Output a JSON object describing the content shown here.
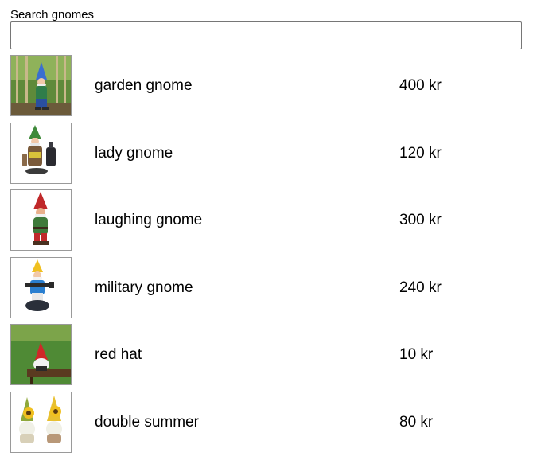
{
  "search": {
    "label": "Search gnomes",
    "value": "",
    "placeholder": ""
  },
  "products": [
    {
      "name": "garden gnome",
      "price": "400 kr",
      "image_icon": "garden-gnome-image"
    },
    {
      "name": "lady gnome",
      "price": "120 kr",
      "image_icon": "lady-gnome-image"
    },
    {
      "name": "laughing gnome",
      "price": "300 kr",
      "image_icon": "laughing-gnome-image"
    },
    {
      "name": "military gnome",
      "price": "240 kr",
      "image_icon": "military-gnome-image"
    },
    {
      "name": "red hat",
      "price": "10 kr",
      "image_icon": "red-hat-gnome-image"
    },
    {
      "name": "double summer",
      "price": "80 kr",
      "image_icon": "double-summer-gnome-image"
    }
  ]
}
